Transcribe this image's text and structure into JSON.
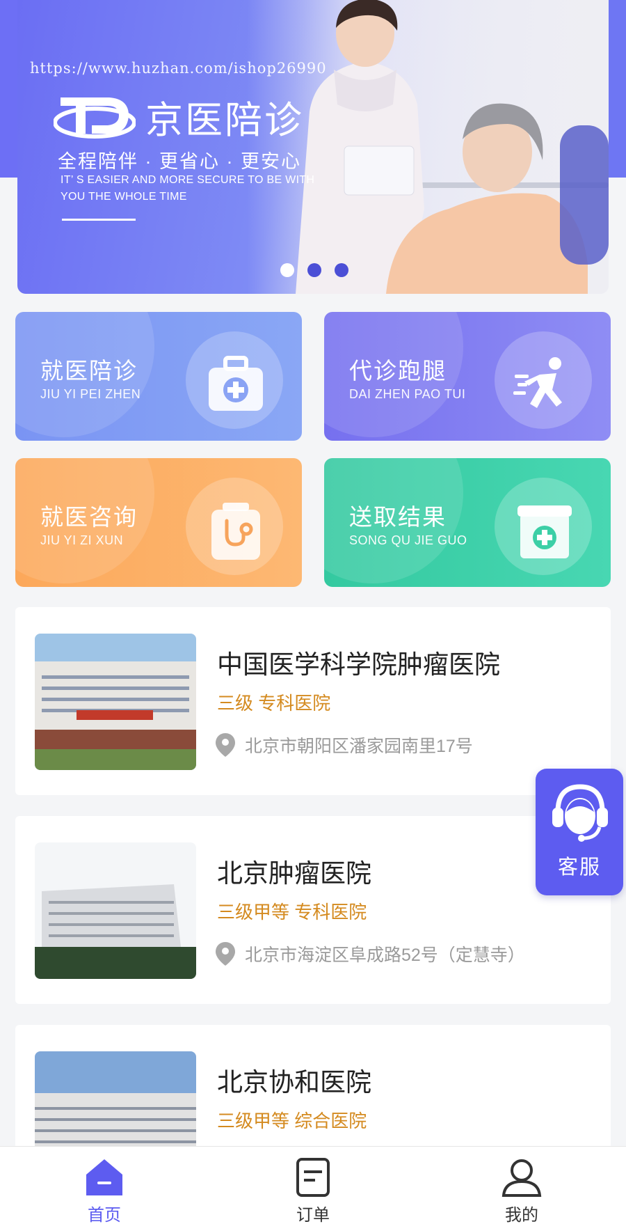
{
  "banner": {
    "watermark": "https://www.huzhan.com/ishop26990",
    "brand_name": "京医陪诊",
    "slogan": "全程陪伴 · 更省心 · 更安心",
    "slogan_en": "IT’ S EASIER AND MORE SECURE TO BE WITH YOU THE WHOLE TIME",
    "carousel": {
      "count": 3,
      "active_index": 0
    }
  },
  "services": [
    {
      "title": "就医陪诊",
      "subtitle": "JIU YI PEI ZHEN",
      "icon": "medical-kit-icon"
    },
    {
      "title": "代诊跑腿",
      "subtitle": "DAI ZHEN PAO TUI",
      "icon": "running-man-icon"
    },
    {
      "title": "就医咨询",
      "subtitle": "JIU YI ZI XUN",
      "icon": "stethoscope-icon"
    },
    {
      "title": "送取结果",
      "subtitle": "SONG QU JIE GUO",
      "icon": "medical-box-icon"
    }
  ],
  "hospitals": [
    {
      "name": "中国医学科学院肿瘤医院",
      "level": "三级 专科医院",
      "address": "北京市朝阳区潘家园南里17号"
    },
    {
      "name": "北京肿瘤医院",
      "level": "三级甲等 专科医院",
      "address": "北京市海淀区阜成路52号（定慧寺）"
    },
    {
      "name": "北京协和医院",
      "level": "三级甲等 综合医院",
      "address": ""
    }
  ],
  "customer_service": {
    "label": "客服"
  },
  "tabbar": {
    "items": [
      {
        "label": "首页",
        "icon": "home-icon",
        "active": true
      },
      {
        "label": "订单",
        "icon": "order-icon",
        "active": false
      },
      {
        "label": "我的",
        "icon": "user-icon",
        "active": false
      }
    ]
  },
  "colors": {
    "brand": "#5d5cf0",
    "level_text": "#d48a1f",
    "address_text": "#9a9a9a"
  }
}
